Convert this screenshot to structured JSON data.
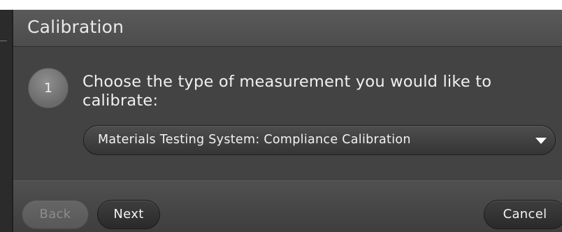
{
  "dialog": {
    "title": "Calibration"
  },
  "step": {
    "number": "1",
    "question": "Choose the type of measurement you would like to calibrate:"
  },
  "measurement_select": {
    "selected_value": "Materials Testing System: Compliance Calibration",
    "icon": "chevron-down-icon"
  },
  "footer": {
    "back_label": "Back",
    "back_enabled": false,
    "next_label": "Next",
    "cancel_label": "Cancel"
  },
  "colors": {
    "dialog_background": "#434343",
    "titlebar": "#545454",
    "text": "#f0f0f0",
    "disabled_text": "#8c8c8c"
  }
}
